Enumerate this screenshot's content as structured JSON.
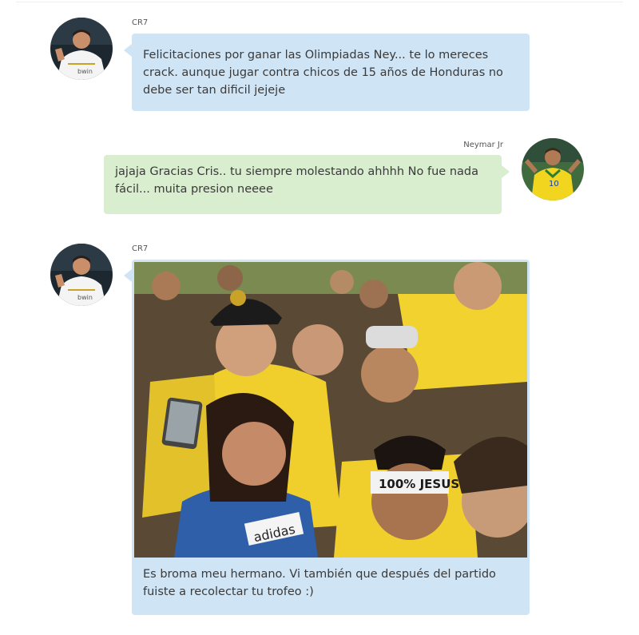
{
  "messages": [
    {
      "sender": "CR7",
      "side": "left",
      "text": "Felicitaciones por ganar las Olimpiadas Ney... te lo mereces crack. aunque jugar contra chicos de 15 años de Honduras no debe ser tan dificil jejeje"
    },
    {
      "sender": "Neymar Jr",
      "side": "right",
      "text": "jajaja Gracias Cris.. tu siempre molestando ahhhh No fue nada fácil... muita presion neeee"
    },
    {
      "sender": "CR7",
      "side": "left",
      "photo_text": {
        "headband": "100% JESUS",
        "shirt": "adidas"
      },
      "text": "Es broma meu hermano. Vi también que después del partido fuiste a recolectar tu trofeo :)"
    }
  ],
  "colors": {
    "incoming_bubble": "#cfe4f5",
    "outgoing_bubble": "#d9edcf",
    "text": "#3a3a3a"
  },
  "icons": [
    "cr7-avatar",
    "neymar-avatar",
    "crowd-photo"
  ]
}
